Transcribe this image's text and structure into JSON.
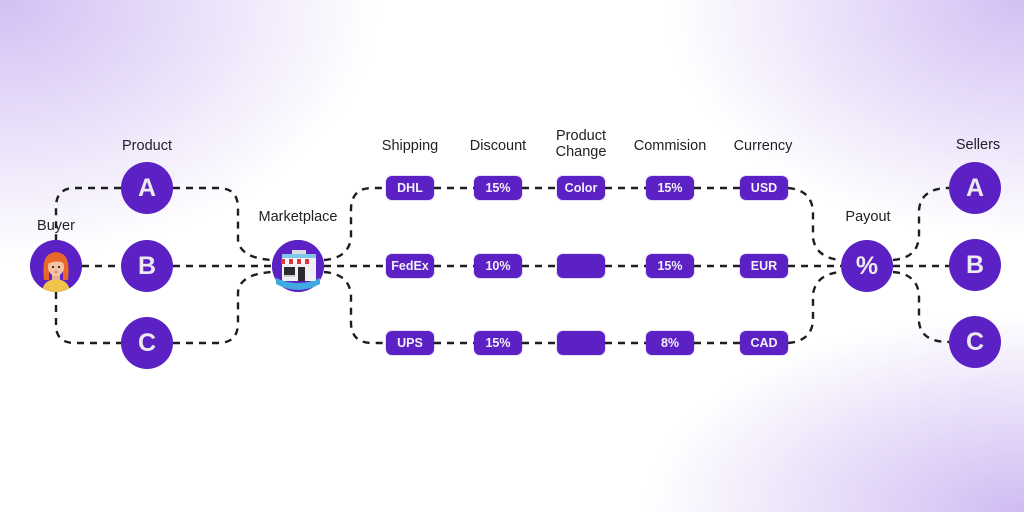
{
  "colors": {
    "node": "#5b21c4",
    "node_text": "#ece9f3",
    "connector": "#1e1e22",
    "background_tint": "#c4aaf0"
  },
  "buyer": {
    "label": "Buyer",
    "icon": "person-avatar-icon"
  },
  "product": {
    "label": "Product",
    "options": [
      "A",
      "B",
      "C"
    ]
  },
  "marketplace": {
    "label": "Marketplace",
    "icon": "storefront-icon"
  },
  "columns": {
    "shipping": "Shipping",
    "discount": "Discount",
    "product_change_line1": "Product",
    "product_change_line2": "Change",
    "commission": "Commision",
    "currency": "Currency"
  },
  "rows": [
    {
      "shipping": "DHL",
      "discount": "15%",
      "product_change": "Color",
      "commission": "15%",
      "currency": "USD"
    },
    {
      "shipping": "FedEx",
      "discount": "10%",
      "product_change": "",
      "commission": "15%",
      "currency": "EUR"
    },
    {
      "shipping": "UPS",
      "discount": "15%",
      "product_change": "",
      "commission": "8%",
      "currency": "CAD"
    }
  ],
  "payout": {
    "label": "Payout",
    "symbol": "%"
  },
  "sellers": {
    "label": "Sellers",
    "options": [
      "A",
      "B",
      "C"
    ]
  }
}
